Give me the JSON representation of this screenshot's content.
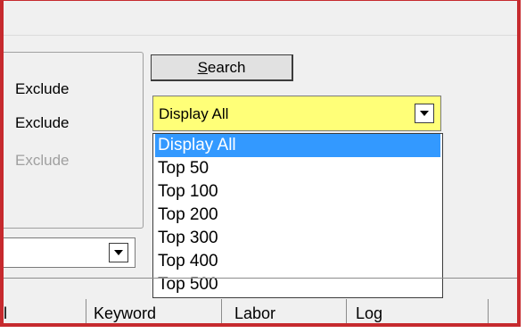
{
  "search_panel": {
    "exclude_labels": [
      "Exclude",
      "Exclude",
      "Exclude"
    ],
    "search_button": {
      "label_first": "S",
      "label_rest": "earch"
    },
    "display_combo": {
      "value": "Display All"
    }
  },
  "dropdown": {
    "options": [
      "Display All",
      "Top 50",
      "Top 100",
      "Top 200",
      "Top 300",
      "Top 400",
      "Top 500"
    ],
    "selected_index": 0
  },
  "tabs": [
    "l",
    "Keyword",
    "Labor",
    "Log"
  ],
  "colors": {
    "combo_bg": "#ffff78",
    "highlight": "#3399ff",
    "frame_border": "#c62a2e"
  }
}
